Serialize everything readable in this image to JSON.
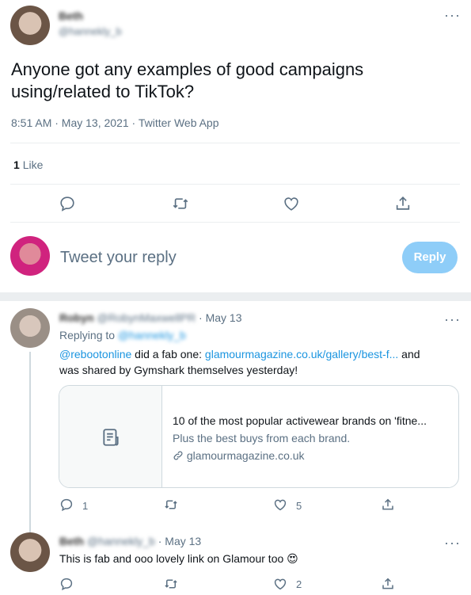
{
  "main_tweet": {
    "author_name": "Beth",
    "author_handle": "@hannekly_b",
    "text_line1": "Anyone got any examples of good campaigns",
    "text_line2": "using/related to TikTok?",
    "timestamp": "8:51 AM · May 13, 2021 · Twitter Web App",
    "likes_count": "1",
    "likes_label": "Like"
  },
  "reply_box": {
    "placeholder": "Tweet your reply",
    "button_label": "Reply"
  },
  "reply1": {
    "author_name": "Robyn",
    "author_handle": "@RobynMaxwellPR",
    "date": "· May 13",
    "replying_to_label": "Replying to",
    "replying_to_handle": "@hannekly_b",
    "mention": "@rebootonline",
    "text_mid": " did a fab one: ",
    "link": "glamourmagazine.co.uk/gallery/best-f...",
    "text_end": " and",
    "text_line2": "was shared by Gymshark themselves yesterday!",
    "card": {
      "title": "10 of the most popular activewear brands on 'fitne...",
      "description": "Plus the best buys from each brand.",
      "domain": "glamourmagazine.co.uk",
      "icon": "document-icon"
    },
    "reply_count": "1",
    "like_count": "5"
  },
  "reply2": {
    "author_name": "Beth",
    "author_handle": "@hannekly_b",
    "date": "· May 13",
    "text": "This is fab and ooo lovely link on Glamour too",
    "emoji": "😍",
    "like_count": "2"
  },
  "colors": {
    "accent": "#1da1f2",
    "reply_button_disabled": "#8ecdf8",
    "muted_text": "#5b7083",
    "divider": "#ebeef0"
  }
}
